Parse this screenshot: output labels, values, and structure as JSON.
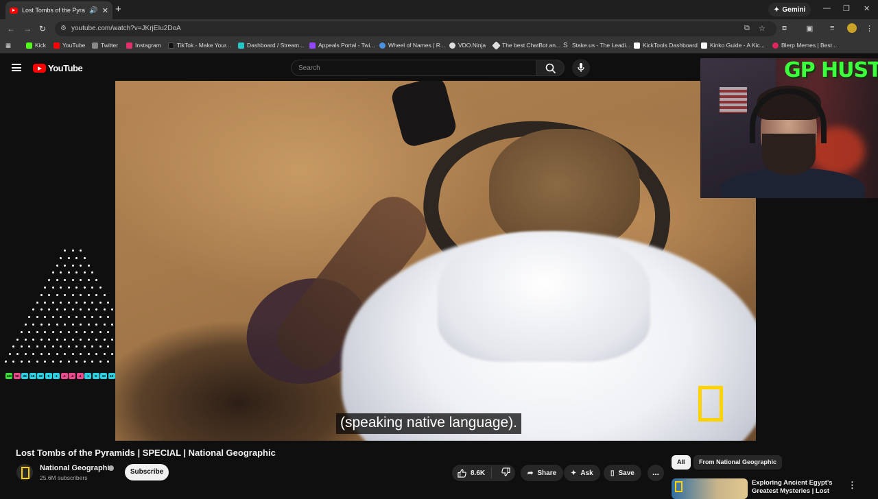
{
  "browser": {
    "tab_title": "Lost Tombs of the Pyramids",
    "new_tab": "+",
    "gemini_label": "Gemini",
    "url": "youtube.com/watch?v=JKrjEIu2DoA",
    "bookmarks": [
      {
        "label": "Kick",
        "color": "#53fc18"
      },
      {
        "label": "YouTube",
        "color": "#ff0000"
      },
      {
        "label": "Twitter",
        "color": "#888888"
      },
      {
        "label": "Instagram",
        "color": "#e1306c"
      },
      {
        "label": "TikTok - Make Your...",
        "color": "#111111"
      },
      {
        "label": "Dashboard / Stream...",
        "color": "#24c8c8"
      },
      {
        "label": "Appeals Portal - Twi...",
        "color": "#9146ff"
      },
      {
        "label": "Wheel of Names | R...",
        "color": "#4a90e2"
      },
      {
        "label": "VDO.Ninja",
        "color": "#dddddd"
      },
      {
        "label": "The best ChatBot an...",
        "color": "#dddddd"
      },
      {
        "label": "Stake.us - The Leadi...",
        "color": "#dddddd"
      },
      {
        "label": "KickTools Dashboard",
        "color": "#ffffff"
      },
      {
        "label": "Kinko Guide - A Kic...",
        "color": "#ffffff"
      },
      {
        "label": "Blerp Memes | Best...",
        "color": "#e0245e"
      }
    ]
  },
  "masthead": {
    "logo_text": "YouTube",
    "search_placeholder": "Search"
  },
  "player": {
    "subtitle": "(speaking native language)."
  },
  "overlay": {
    "webcam_title": "GP HUSTLA",
    "plinko_slots": [
      {
        "label": "110",
        "color": "#3cdc3c"
      },
      {
        "label": "50",
        "color": "#e84a8c"
      },
      {
        "label": "25",
        "color": "#2ad0e0"
      },
      {
        "label": "10",
        "color": "#2ad0e0"
      },
      {
        "label": "10",
        "color": "#2ad0e0"
      },
      {
        "label": "5",
        "color": "#2ad0e0"
      },
      {
        "label": "1",
        "color": "#2ad0e0"
      },
      {
        "label": ".1",
        "color": "#e84a8c"
      },
      {
        "label": ".2",
        "color": "#e84a8c"
      },
      {
        "label": ".1",
        "color": "#e84a8c"
      },
      {
        "label": "1",
        "color": "#2ad0e0"
      },
      {
        "label": "5",
        "color": "#2ad0e0"
      },
      {
        "label": "10",
        "color": "#2ad0e0"
      },
      {
        "label": "10",
        "color": "#2ad0e0"
      },
      {
        "label": "25",
        "color": "#2ad0e0"
      },
      {
        "label": "50",
        "color": "#e84a8c"
      },
      {
        "label": "110",
        "color": "#3cdc3c"
      }
    ]
  },
  "video": {
    "title": "Lost Tombs of the Pyramids | SPECIAL | National Geographic",
    "channel_name": "National Geographic",
    "subscribers": "25.6M subscribers",
    "subscribe_label": "Subscribe",
    "like_count": "8.6K",
    "share_label": "Share",
    "ask_label": "Ask",
    "save_label": "Save",
    "more_label": "..."
  },
  "sidebar": {
    "chips": [
      "All",
      "From National Geographic"
    ],
    "recommendation_title": "Exploring Ancient Egypt's Greatest Mysteries | Lost"
  }
}
